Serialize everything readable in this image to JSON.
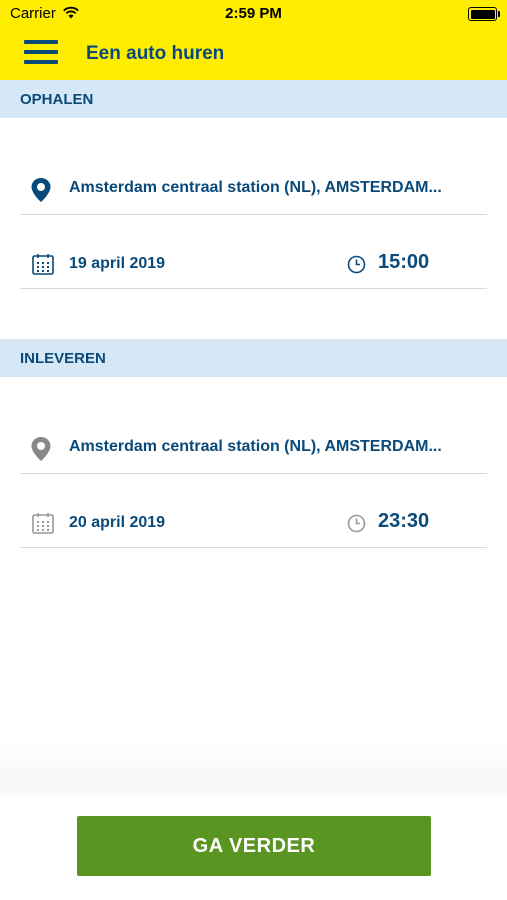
{
  "status_bar": {
    "carrier": "Carrier",
    "time": "2:59 PM"
  },
  "header": {
    "title": "Een auto huren",
    "background_color": "#ffed00"
  },
  "pickup": {
    "section_label": "OPHALEN",
    "location": "Amsterdam centraal station (NL), AMSTERDAM...",
    "location_icon_color": "#0a4a7a",
    "date": "19 april 2019",
    "time": "15:00",
    "icon_color": "#0a4a7a"
  },
  "return": {
    "section_label": "INLEVEREN",
    "location": "Amsterdam centraal station (NL), AMSTERDAM...",
    "location_icon_color": "#888888",
    "date": "20 april 2019",
    "time": "23:30",
    "icon_color": "#999999"
  },
  "cta": {
    "label": "GA VERDER",
    "color": "#5a9522"
  },
  "icons": [
    "menu-icon",
    "location-pin-icon",
    "calendar-icon",
    "clock-icon",
    "wifi-icon",
    "battery-icon"
  ]
}
